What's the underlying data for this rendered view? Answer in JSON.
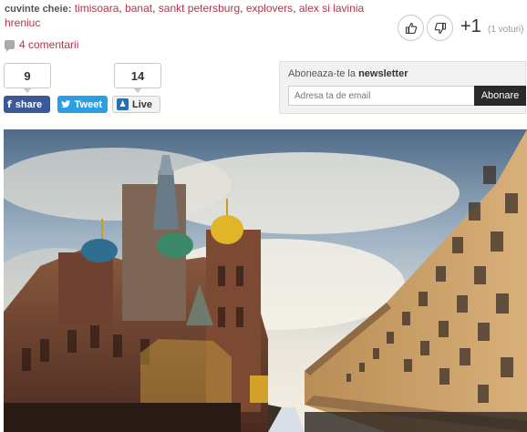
{
  "article": {
    "keywords_label": "cuvinte cheie:",
    "keywords": [
      "timisoara",
      "banat",
      "sankt petersburg",
      "explovers",
      "alex si lavinia hreniuc"
    ],
    "comments": "4 comentarii"
  },
  "rating": {
    "score": "+1",
    "votes": "(1 voturi)",
    "like_icon": "thumbs-up-icon",
    "dislike_icon": "thumbs-down-icon"
  },
  "share": {
    "facebook_count": "9",
    "facebook_label": "share",
    "twitter_label": "Tweet",
    "live_count": "14",
    "live_label": "Live"
  },
  "newsletter": {
    "title_prefix": "Aboneaza-te la ",
    "title_bold": "newsletter",
    "placeholder": "Adresa ta de email",
    "button": "Abonare"
  },
  "photo": {
    "subject": "Church of the Savior on Spilled Blood and canal, Saint Petersburg"
  },
  "colors": {
    "link": "#b0364a",
    "facebook": "#3b5998",
    "twitter": "#2b9fe3",
    "newsletter_button": "#2a2a2a"
  }
}
